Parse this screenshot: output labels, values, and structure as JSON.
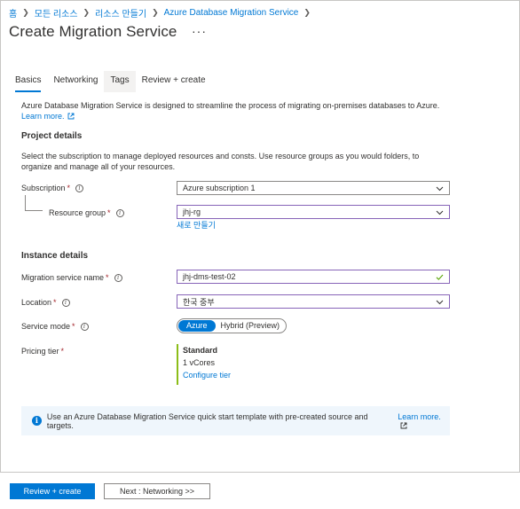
{
  "breadcrumb": {
    "items": [
      "홈",
      "모든 리소스",
      "리소스 만들기",
      "Azure Database Migration Service"
    ]
  },
  "page": {
    "title": "Create Migration Service",
    "more_label": "···"
  },
  "tabs": [
    {
      "label": "Basics",
      "active": true
    },
    {
      "label": "Networking",
      "active": false
    },
    {
      "label": "Tags",
      "active": false
    },
    {
      "label": "Review + create",
      "active": false
    }
  ],
  "intro": {
    "text": "Azure Database Migration Service is designed to streamline the process of migrating on-premises databases to Azure.",
    "learn_more": "Learn more."
  },
  "project": {
    "heading": "Project details",
    "description": "Select the subscription to manage deployed resources and consts. Use resource groups as you would folders, to organize and manage all of your resources.",
    "subscription_label": "Subscription",
    "subscription_value": "Azure subscription 1",
    "resource_group_label": "Resource group",
    "resource_group_value": "jhj-rg",
    "create_new": "새로 만들기"
  },
  "instance": {
    "heading": "Instance details",
    "name_label": "Migration service name",
    "name_value": "jhj-dms-test-02",
    "location_label": "Location",
    "location_value": "한국 중부",
    "mode_label": "Service mode",
    "mode_options": [
      "Azure",
      "Hybrid (Preview)"
    ],
    "mode_selected": "Azure",
    "pricing_label": "Pricing tier",
    "pricing_name": "Standard",
    "pricing_cores": "1 vCores",
    "configure_tier": "Configure tier"
  },
  "required_mark": "*",
  "banner": {
    "text": "Use an Azure Database Migration Service quick start template with pre-created source and targets.",
    "learn_more": "Learn more."
  },
  "footer": {
    "primary": "Review + create",
    "secondary": "Next : Networking >>"
  },
  "colors": {
    "accent": "#0078d4",
    "focus_border": "#8764b8",
    "valid_check": "#57a300",
    "tier_bar": "#8cbd18",
    "banner_bg": "#eff6fc"
  }
}
